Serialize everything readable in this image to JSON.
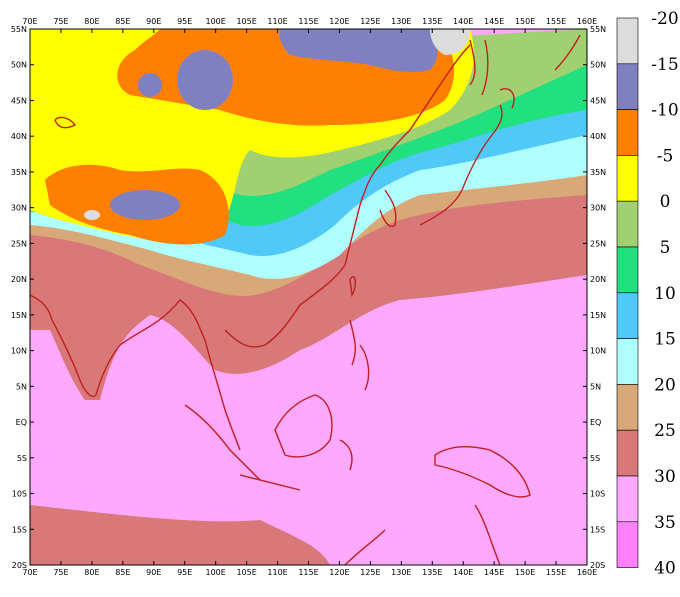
{
  "map": {
    "lon_labels": [
      "70E",
      "75E",
      "80E",
      "85E",
      "90E",
      "95E",
      "100E",
      "105E",
      "110E",
      "115E",
      "120E",
      "125E",
      "130E",
      "135E",
      "140E",
      "145E",
      "150E",
      "155E",
      "160E"
    ],
    "lat_labels": [
      "55N",
      "50N",
      "45N",
      "40N",
      "35N",
      "30N",
      "25N",
      "20N",
      "15N",
      "10N",
      "5N",
      "EQ",
      "5S",
      "10S",
      "15S",
      "20S"
    ],
    "extent": {
      "lon_min": 70,
      "lon_max": 160,
      "lat_min": -20,
      "lat_max": 55
    }
  },
  "legend": {
    "labels": [
      "-20",
      "-15",
      "-10",
      "-5",
      "0",
      "5",
      "10",
      "15",
      "20",
      "25",
      "30",
      "35",
      "40"
    ],
    "colors": [
      "#dcdcdc",
      "#8080c0",
      "#ff8000",
      "#ffff00",
      "#a0d070",
      "#20e080",
      "#50c8f8",
      "#b0ffff",
      "#d8a878",
      "#d87878",
      "#ffa8ff",
      "#ff80ff"
    ]
  },
  "colors": {
    "coast": "#c02020",
    "frame": "#000000"
  }
}
